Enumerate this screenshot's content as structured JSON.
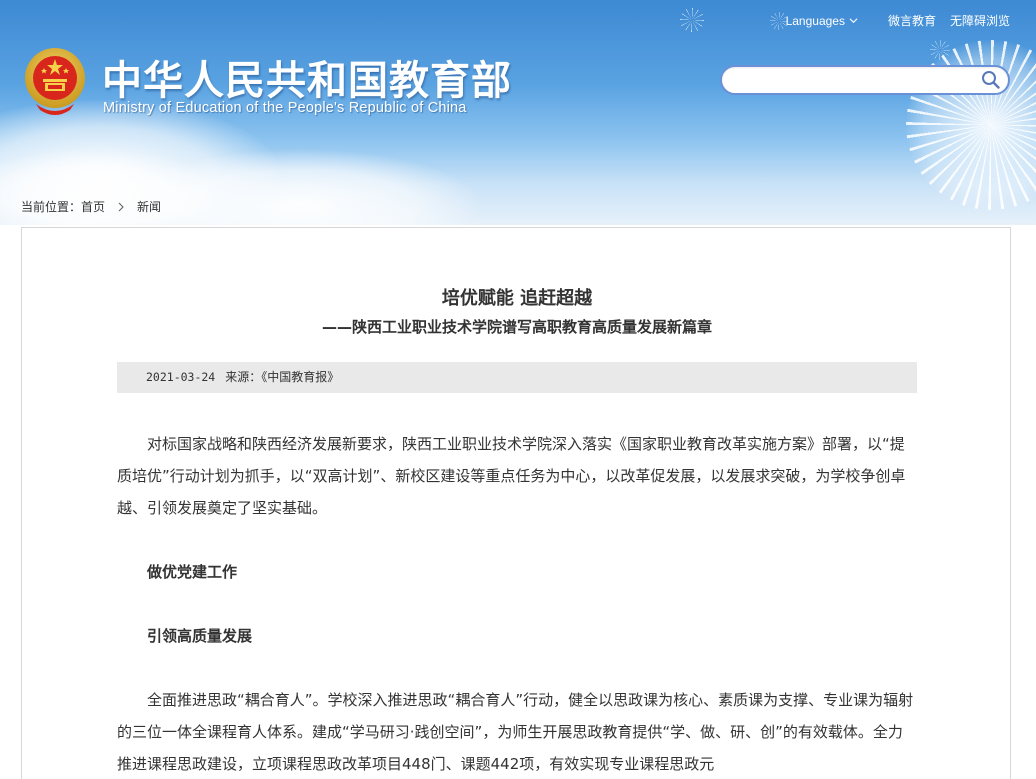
{
  "header": {
    "title_cn": "中华人民共和国教育部",
    "title_en": "Ministry of Education of the People's Republic of China",
    "top_links": {
      "languages": "Languages",
      "weibo": "微言教育",
      "accessibility": "无障碍浏览"
    },
    "search": {
      "placeholder": "",
      "value": ""
    }
  },
  "breadcrumb": {
    "label": "当前位置：",
    "home": "首页",
    "current": "新闻"
  },
  "article": {
    "title": "培优赋能 追赶超越",
    "subtitle": "——陕西工业职业技术学院谱写高职教育高质量发展新篇章",
    "date": "2021-03-24",
    "source_label": "来源：",
    "source": "《中国教育报》",
    "paragraphs": {
      "p1": "对标国家战略和陕西经济发展新要求，陕西工业职业技术学院深入落实《国家职业教育改革实施方案》部署，以“提质培优”行动计划为抓手，以“双高计划”、新校区建设等重点任务为中心，以改革促发展，以发展求突破，为学校争创卓越、引领发展奠定了坚实基础。",
      "h1": "做优党建工作",
      "h2": "引领高质量发展",
      "p2": "全面推进思政“耦合育人”。学校深入推进思政“耦合育人”行动，健全以思政课为核心、素质课为支撑、专业课为辐射的三位一体全课程育人体系。建成“学马研习·践创空间”，为师生开展思政教育提供“学、做、研、创”的有效载体。全力推进课程思政建设，立项课程思政改革项目448门、课题442项，有效实现专业课程思政元"
    }
  },
  "colors": {
    "header_blue": "#3d89d3",
    "search_border": "#6a91d8",
    "meta_bar_bg": "#e9e9e9",
    "text": "#333333"
  }
}
